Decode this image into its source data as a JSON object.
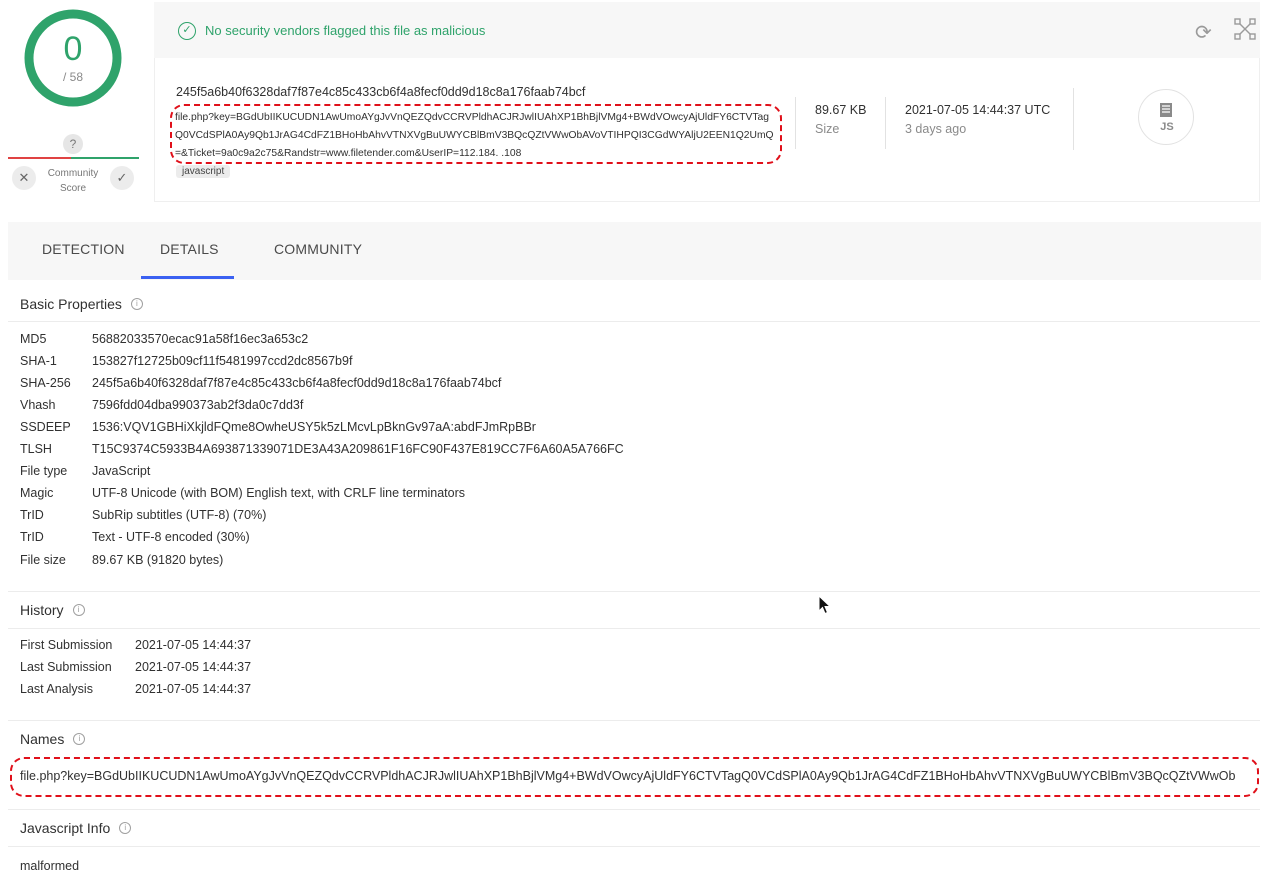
{
  "score": {
    "detected": "0",
    "total": "/ 58",
    "color": "#2fa36b"
  },
  "community": {
    "unknown_glyph": "?",
    "label": "Community Score",
    "down_glyph": "✕",
    "up_glyph": "✓"
  },
  "banner": {
    "status_text": "No security vendors flagged this file as malicious",
    "status_icon": "check-circle-icon"
  },
  "file": {
    "sha256": "245f5a6b40f6328daf7f87e4c85c433cb6f4a8fecf0dd9d18c8a176faab74bcf",
    "name": "file.php?key=BGdUbIIKUCUDN1AwUmoAYgJvVnQEZQdvCCRVPldhACJRJwlIUAhXP1BhBjlVMg4+BWdVOwcyAjUldFY6CTVTagQ0VCdSPlA0Ay9Qb1JrAG4CdFZ1BHoHbAhvVTNXVgBuUWYCBlBmV3BQcQZtVWwObAVoVTIHPQI3CGdWYAljU2EEN1Q2UmQ=&Ticket=9a0c9a2c75&Randstr=www.filetender.com&UserIP=112.184.  .108",
    "tag": "javascript",
    "size_value": "89.67 KB",
    "size_label": "Size",
    "date_value": "2021-07-05 14:44:37 UTC",
    "date_label": "3 days ago",
    "type_icon_text": "JS"
  },
  "tabs": [
    {
      "label": "DETECTION"
    },
    {
      "label": "DETAILS",
      "active": true
    },
    {
      "label": "COMMUNITY"
    }
  ],
  "basic_properties": {
    "title": "Basic Properties",
    "rows": [
      {
        "key": "MD5",
        "value": "56882033570ecac91a58f16ec3a653c2"
      },
      {
        "key": "SHA-1",
        "value": "153827f12725b09cf11f5481997ccd2dc8567b9f"
      },
      {
        "key": "SHA-256",
        "value": "245f5a6b40f6328daf7f87e4c85c433cb6f4a8fecf0dd9d18c8a176faab74bcf"
      },
      {
        "key": "Vhash",
        "value": "7596fdd04dba990373ab2f3da0c7dd3f"
      },
      {
        "key": "SSDEEP",
        "value": "1536:VQV1GBHiXkjldFQme8OwheUSY5k5zLMcvLpBknGv97aA:abdFJmRpBBr"
      },
      {
        "key": "TLSH",
        "value": "T15C9374C5933B4A693871339071DE3A43A209861F16FC90F437E819CC7F6A60A5A766FC"
      },
      {
        "key": "File type",
        "value": "JavaScript"
      },
      {
        "key": "Magic",
        "value": "UTF-8 Unicode (with BOM) English text, with CRLF line terminators"
      },
      {
        "key": "TrID",
        "value": "SubRip subtitles (UTF-8) (70%)"
      },
      {
        "key": "TrID",
        "value": "Text - UTF-8 encoded (30%)"
      },
      {
        "key": "File size",
        "value": "89.67 KB (91820 bytes)"
      }
    ]
  },
  "history": {
    "title": "History",
    "rows": [
      {
        "key": "First Submission",
        "value": "2021-07-05 14:44:37"
      },
      {
        "key": "Last Submission",
        "value": "2021-07-05 14:44:37"
      },
      {
        "key": "Last Analysis",
        "value": "2021-07-05 14:44:37"
      }
    ]
  },
  "names": {
    "title": "Names",
    "value": "file.php?key=BGdUbIIKUCUDN1AwUmoAYgJvVnQEZQdvCCRVPldhACJRJwlIUAhXP1BhBjlVMg4+BWdVOwcyAjUldFY6CTVTagQ0VCdSPlA0Ay9Qb1JrAG4CdFZ1BHoHbAhvVTNXVgBuUWYCBlBmV3BQcQZtVWwOb"
  },
  "javascript_info": {
    "title": "Javascript Info",
    "value": "malformed"
  },
  "info_glyph": "i"
}
